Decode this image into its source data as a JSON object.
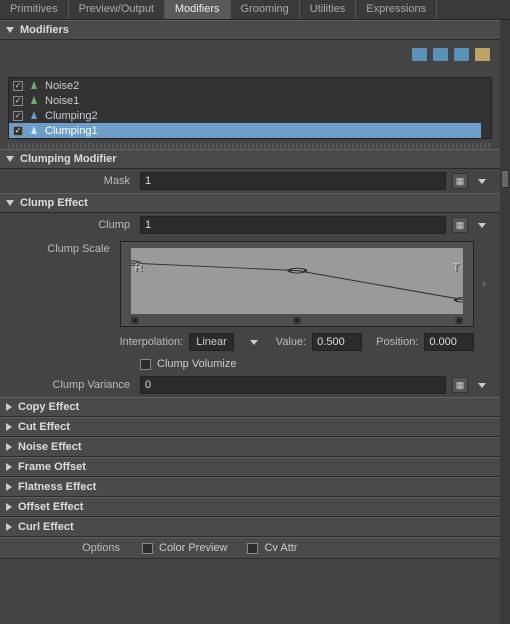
{
  "tabs": {
    "primitives": "Primitives",
    "preview": "Preview/Output",
    "modifiers": "Modifiers",
    "grooming": "Grooming",
    "utilities": "Utilities",
    "expressions": "Expressions"
  },
  "modifiers_section": {
    "title": "Modifiers"
  },
  "modifier_list": {
    "items": [
      {
        "label": "Noise2",
        "checked": true
      },
      {
        "label": "Noise1",
        "checked": true
      },
      {
        "label": "Clumping2",
        "checked": true
      },
      {
        "label": "Clumping1",
        "checked": true,
        "selected": true
      }
    ]
  },
  "clumping_modifier": {
    "title": "Clumping Modifier"
  },
  "mask": {
    "label": "Mask",
    "value": "1"
  },
  "clump_effect": {
    "title": "Clump Effect"
  },
  "clump": {
    "label": "Clump",
    "value": "1"
  },
  "clump_scale": {
    "label": "Clump Scale",
    "left_marker": "R",
    "right_marker": "T",
    "interp_label": "Interpolation:",
    "interp_value": "Linear",
    "value_label": "Value:",
    "value": "0.500",
    "pos_label": "Position:",
    "pos": "0.000"
  },
  "clump_volumize": {
    "label": "Clump Volumize"
  },
  "clump_variance": {
    "label": "Clump Variance",
    "value": "0"
  },
  "collapsed": {
    "copy": "Copy Effect",
    "cut": "Cut Effect",
    "noise": "Noise Effect",
    "frame": "Frame Offset",
    "flatness": "Flatness Effect",
    "offset": "Offset Effect",
    "curl": "Curl Effect"
  },
  "options": {
    "label": "Options",
    "color_preview": "Color Preview",
    "cv_attr": "Cv Attr"
  },
  "chart_data": {
    "type": "line",
    "title": "Clump Scale",
    "xlabel": "Position",
    "ylabel": "Value",
    "x": [
      0.0,
      0.5,
      1.0
    ],
    "y": [
      0.8,
      0.7,
      0.3
    ],
    "xlim": [
      0,
      1
    ],
    "ylim": [
      0,
      1
    ]
  }
}
